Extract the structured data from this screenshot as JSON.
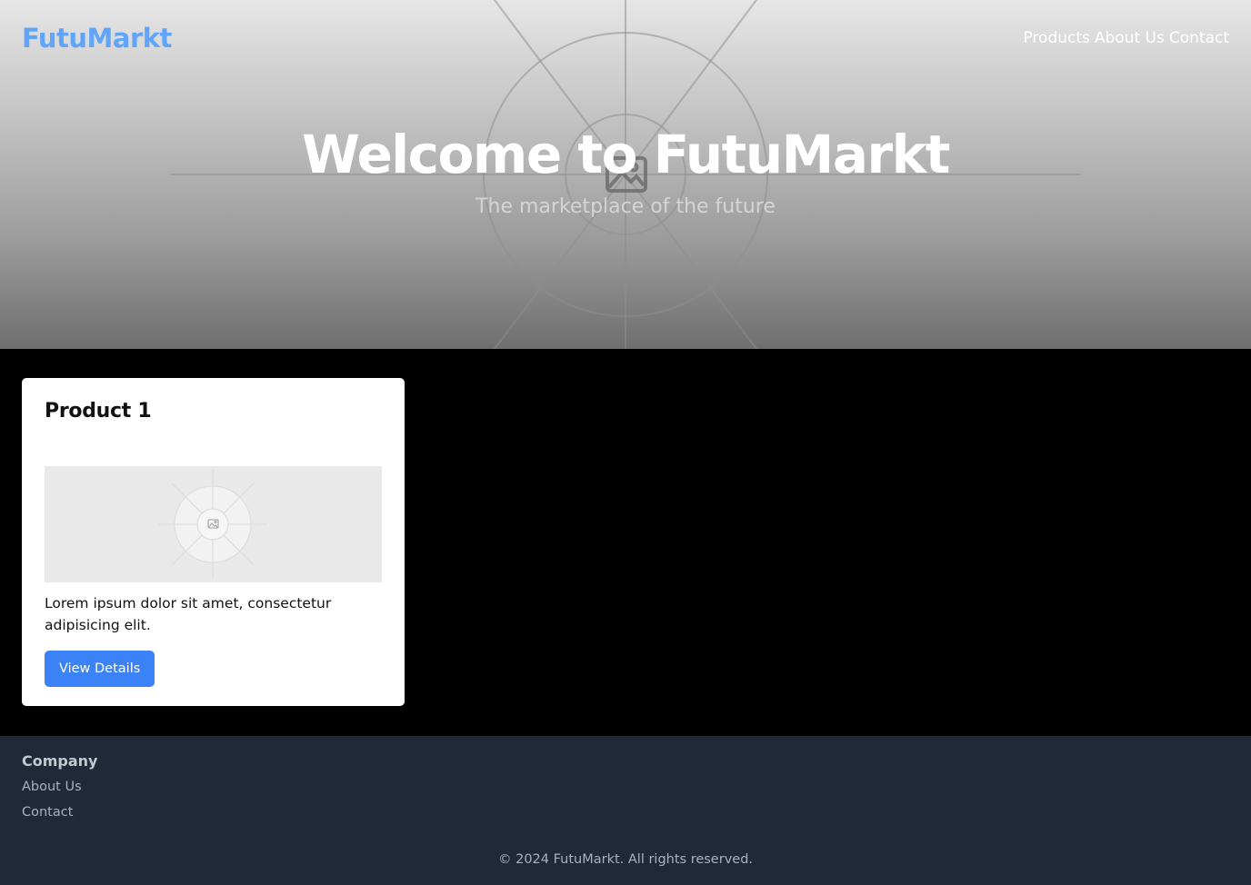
{
  "colors": {
    "brand": "#60a5fa",
    "button": "#3b82f6",
    "footer_bg": "#1f2937",
    "page_bg": "#000000"
  },
  "header": {
    "brand": "FutuMarkt",
    "nav": {
      "products": "Products",
      "about": "About Us",
      "contact": "Contact"
    }
  },
  "hero": {
    "title": "Welcome to FutuMarkt",
    "subtitle": "The marketplace of the future",
    "background_icon": "image-placeholder-icon"
  },
  "products": [
    {
      "title": "Product 1",
      "image_icon": "image-placeholder-icon",
      "description": "Lorem ipsum dolor sit amet, consectetur adipisicing elit.",
      "button_label": "View Details"
    }
  ],
  "footer": {
    "heading": "Company",
    "links": {
      "about": "About Us",
      "contact": "Contact"
    },
    "copyright": "© 2024 FutuMarkt. All rights reserved."
  }
}
